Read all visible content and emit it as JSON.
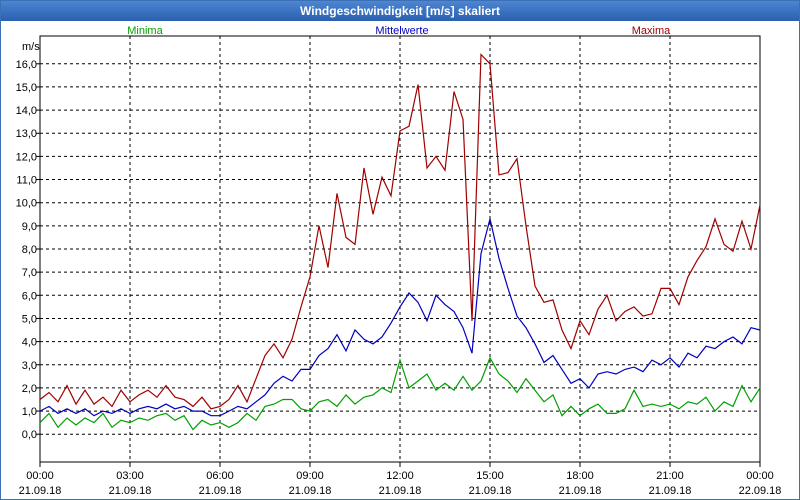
{
  "window": {
    "title": "Windgeschwindigkeit [m/s] skaliert"
  },
  "chart_data": {
    "type": "line",
    "title": "Windgeschwindigkeit [m/s] skaliert",
    "ylabel": "m/s",
    "xlabel": "",
    "ylim": [
      -1.2,
      17.2
    ],
    "xlim_hours": [
      0,
      24
    ],
    "yticks": [
      "0,0",
      "1,0",
      "2,0",
      "3,0",
      "4,0",
      "5,0",
      "6,0",
      "7,0",
      "8,0",
      "9,0",
      "10,0",
      "11,0",
      "12,0",
      "13,0",
      "14,0",
      "15,0",
      "16,0"
    ],
    "ytick_values": [
      0,
      1,
      2,
      3,
      4,
      5,
      6,
      7,
      8,
      9,
      10,
      11,
      12,
      13,
      14,
      15,
      16
    ],
    "xticks": [
      {
        "time": "00:00",
        "date": "21.09.18",
        "hour": 0
      },
      {
        "time": "03:00",
        "date": "21.09.18",
        "hour": 3
      },
      {
        "time": "06:00",
        "date": "21.09.18",
        "hour": 6
      },
      {
        "time": "09:00",
        "date": "21.09.18",
        "hour": 9
      },
      {
        "time": "12:00",
        "date": "21.09.18",
        "hour": 12
      },
      {
        "time": "15:00",
        "date": "21.09.18",
        "hour": 15
      },
      {
        "time": "18:00",
        "date": "21.09.18",
        "hour": 18
      },
      {
        "time": "21:00",
        "date": "21.09.18",
        "hour": 21
      },
      {
        "time": "00:00",
        "date": "22.09.18",
        "hour": 24
      }
    ],
    "grid": true,
    "legend_position": "top",
    "series": [
      {
        "name": "Minima",
        "color": "#00a000",
        "points": [
          [
            0,
            0.5
          ],
          [
            0.3,
            0.9
          ],
          [
            0.6,
            0.3
          ],
          [
            0.9,
            0.7
          ],
          [
            1.2,
            0.4
          ],
          [
            1.5,
            0.7
          ],
          [
            1.8,
            0.5
          ],
          [
            2.1,
            0.9
          ],
          [
            2.4,
            0.3
          ],
          [
            2.7,
            0.6
          ],
          [
            3.0,
            0.5
          ],
          [
            3.3,
            0.7
          ],
          [
            3.6,
            0.6
          ],
          [
            3.9,
            0.8
          ],
          [
            4.2,
            0.9
          ],
          [
            4.5,
            0.6
          ],
          [
            4.8,
            0.8
          ],
          [
            5.1,
            0.2
          ],
          [
            5.4,
            0.6
          ],
          [
            5.7,
            0.4
          ],
          [
            6.0,
            0.5
          ],
          [
            6.3,
            0.3
          ],
          [
            6.6,
            0.5
          ],
          [
            6.9,
            0.9
          ],
          [
            7.2,
            0.6
          ],
          [
            7.5,
            1.2
          ],
          [
            7.8,
            1.3
          ],
          [
            8.1,
            1.5
          ],
          [
            8.4,
            1.5
          ],
          [
            8.7,
            1.1
          ],
          [
            9.0,
            1.0
          ],
          [
            9.3,
            1.4
          ],
          [
            9.6,
            1.5
          ],
          [
            9.9,
            1.2
          ],
          [
            10.2,
            1.7
          ],
          [
            10.5,
            1.3
          ],
          [
            10.8,
            1.6
          ],
          [
            11.1,
            1.7
          ],
          [
            11.4,
            2.0
          ],
          [
            11.7,
            1.8
          ],
          [
            12.0,
            3.2
          ],
          [
            12.3,
            2.0
          ],
          [
            12.6,
            2.3
          ],
          [
            12.9,
            2.6
          ],
          [
            13.2,
            1.9
          ],
          [
            13.5,
            2.2
          ],
          [
            13.8,
            1.9
          ],
          [
            14.1,
            2.5
          ],
          [
            14.4,
            1.9
          ],
          [
            14.7,
            2.3
          ],
          [
            15.0,
            3.3
          ],
          [
            15.3,
            2.6
          ],
          [
            15.6,
            2.3
          ],
          [
            15.9,
            1.8
          ],
          [
            16.2,
            2.4
          ],
          [
            16.5,
            1.9
          ],
          [
            16.8,
            1.4
          ],
          [
            17.1,
            1.7
          ],
          [
            17.4,
            0.8
          ],
          [
            17.7,
            1.2
          ],
          [
            18.0,
            0.8
          ],
          [
            18.3,
            1.1
          ],
          [
            18.6,
            1.3
          ],
          [
            18.9,
            0.9
          ],
          [
            19.2,
            0.9
          ],
          [
            19.5,
            1.1
          ],
          [
            19.8,
            1.9
          ],
          [
            20.1,
            1.2
          ],
          [
            20.4,
            1.3
          ],
          [
            20.7,
            1.2
          ],
          [
            21.0,
            1.3
          ],
          [
            21.3,
            1.1
          ],
          [
            21.6,
            1.4
          ],
          [
            21.9,
            1.3
          ],
          [
            22.2,
            1.6
          ],
          [
            22.5,
            1.0
          ],
          [
            22.8,
            1.4
          ],
          [
            23.1,
            1.2
          ],
          [
            23.4,
            2.1
          ],
          [
            23.7,
            1.4
          ],
          [
            24.0,
            2.0
          ]
        ]
      },
      {
        "name": "Mittelwerte",
        "color": "#0000c0",
        "points": [
          [
            0,
            1.0
          ],
          [
            0.3,
            1.2
          ],
          [
            0.6,
            0.9
          ],
          [
            0.9,
            1.1
          ],
          [
            1.2,
            0.9
          ],
          [
            1.5,
            1.1
          ],
          [
            1.8,
            0.8
          ],
          [
            2.1,
            1.0
          ],
          [
            2.4,
            0.9
          ],
          [
            2.7,
            1.1
          ],
          [
            3.0,
            0.9
          ],
          [
            3.3,
            1.1
          ],
          [
            3.6,
            1.2
          ],
          [
            3.9,
            1.1
          ],
          [
            4.2,
            1.3
          ],
          [
            4.5,
            1.1
          ],
          [
            4.8,
            1.2
          ],
          [
            5.1,
            1.0
          ],
          [
            5.4,
            1.0
          ],
          [
            5.7,
            0.8
          ],
          [
            6.0,
            0.8
          ],
          [
            6.3,
            1.0
          ],
          [
            6.6,
            1.2
          ],
          [
            6.9,
            1.1
          ],
          [
            7.2,
            1.4
          ],
          [
            7.5,
            1.7
          ],
          [
            7.8,
            2.2
          ],
          [
            8.1,
            2.5
          ],
          [
            8.4,
            2.3
          ],
          [
            8.7,
            2.8
          ],
          [
            9.0,
            2.8
          ],
          [
            9.3,
            3.4
          ],
          [
            9.6,
            3.7
          ],
          [
            9.9,
            4.3
          ],
          [
            10.2,
            3.6
          ],
          [
            10.5,
            4.5
          ],
          [
            10.8,
            4.1
          ],
          [
            11.1,
            3.9
          ],
          [
            11.4,
            4.2
          ],
          [
            11.7,
            4.8
          ],
          [
            12.0,
            5.5
          ],
          [
            12.3,
            6.1
          ],
          [
            12.6,
            5.7
          ],
          [
            12.9,
            4.9
          ],
          [
            13.2,
            6.0
          ],
          [
            13.5,
            5.6
          ],
          [
            13.8,
            5.3
          ],
          [
            14.1,
            4.6
          ],
          [
            14.4,
            3.5
          ],
          [
            14.7,
            7.8
          ],
          [
            15.0,
            9.3
          ],
          [
            15.3,
            7.6
          ],
          [
            15.6,
            6.3
          ],
          [
            15.9,
            5.1
          ],
          [
            16.2,
            4.6
          ],
          [
            16.5,
            3.9
          ],
          [
            16.8,
            3.1
          ],
          [
            17.1,
            3.4
          ],
          [
            17.4,
            2.8
          ],
          [
            17.7,
            2.2
          ],
          [
            18.0,
            2.4
          ],
          [
            18.3,
            2.0
          ],
          [
            18.6,
            2.6
          ],
          [
            18.9,
            2.7
          ],
          [
            19.2,
            2.6
          ],
          [
            19.5,
            2.8
          ],
          [
            19.8,
            2.9
          ],
          [
            20.1,
            2.7
          ],
          [
            20.4,
            3.2
          ],
          [
            20.7,
            3.0
          ],
          [
            21.0,
            3.3
          ],
          [
            21.3,
            2.9
          ],
          [
            21.6,
            3.5
          ],
          [
            21.9,
            3.3
          ],
          [
            22.2,
            3.8
          ],
          [
            22.5,
            3.7
          ],
          [
            22.8,
            4.0
          ],
          [
            23.1,
            4.2
          ],
          [
            23.4,
            3.9
          ],
          [
            23.7,
            4.6
          ],
          [
            24.0,
            4.5
          ]
        ]
      },
      {
        "name": "Maxima",
        "color": "#a00000",
        "points": [
          [
            0,
            1.5
          ],
          [
            0.3,
            1.8
          ],
          [
            0.6,
            1.4
          ],
          [
            0.9,
            2.1
          ],
          [
            1.2,
            1.3
          ],
          [
            1.5,
            1.9
          ],
          [
            1.8,
            1.3
          ],
          [
            2.1,
            1.6
          ],
          [
            2.4,
            1.2
          ],
          [
            2.7,
            1.9
          ],
          [
            3.0,
            1.4
          ],
          [
            3.3,
            1.7
          ],
          [
            3.6,
            1.9
          ],
          [
            3.9,
            1.6
          ],
          [
            4.2,
            2.1
          ],
          [
            4.5,
            1.6
          ],
          [
            4.8,
            1.5
          ],
          [
            5.1,
            1.2
          ],
          [
            5.4,
            1.6
          ],
          [
            5.7,
            1.1
          ],
          [
            6.0,
            1.2
          ],
          [
            6.3,
            1.5
          ],
          [
            6.6,
            2.1
          ],
          [
            6.9,
            1.4
          ],
          [
            7.2,
            2.4
          ],
          [
            7.5,
            3.4
          ],
          [
            7.8,
            3.9
          ],
          [
            8.1,
            3.3
          ],
          [
            8.4,
            4.1
          ],
          [
            8.7,
            5.5
          ],
          [
            9.0,
            6.8
          ],
          [
            9.3,
            9.0
          ],
          [
            9.6,
            7.2
          ],
          [
            9.9,
            10.4
          ],
          [
            10.2,
            8.5
          ],
          [
            10.5,
            8.2
          ],
          [
            10.8,
            11.5
          ],
          [
            11.1,
            9.5
          ],
          [
            11.4,
            11.1
          ],
          [
            11.7,
            10.3
          ],
          [
            12.0,
            13.1
          ],
          [
            12.3,
            13.3
          ],
          [
            12.6,
            15.1
          ],
          [
            12.9,
            11.5
          ],
          [
            13.2,
            12.0
          ],
          [
            13.5,
            11.4
          ],
          [
            13.8,
            14.8
          ],
          [
            14.1,
            13.6
          ],
          [
            14.4,
            4.9
          ],
          [
            14.7,
            16.4
          ],
          [
            15.0,
            16.0
          ],
          [
            15.3,
            11.2
          ],
          [
            15.6,
            11.3
          ],
          [
            15.9,
            11.9
          ],
          [
            16.2,
            9.0
          ],
          [
            16.5,
            6.4
          ],
          [
            16.8,
            5.7
          ],
          [
            17.1,
            5.8
          ],
          [
            17.4,
            4.5
          ],
          [
            17.7,
            3.7
          ],
          [
            18.0,
            4.9
          ],
          [
            18.3,
            4.3
          ],
          [
            18.6,
            5.4
          ],
          [
            18.9,
            6.0
          ],
          [
            19.2,
            4.9
          ],
          [
            19.5,
            5.3
          ],
          [
            19.8,
            5.5
          ],
          [
            20.1,
            5.1
          ],
          [
            20.4,
            5.2
          ],
          [
            20.7,
            6.3
          ],
          [
            21.0,
            6.3
          ],
          [
            21.3,
            5.6
          ],
          [
            21.6,
            6.8
          ],
          [
            21.9,
            7.5
          ],
          [
            22.2,
            8.1
          ],
          [
            22.5,
            9.3
          ],
          [
            22.8,
            8.2
          ],
          [
            23.1,
            7.9
          ],
          [
            23.4,
            9.2
          ],
          [
            23.7,
            8.0
          ],
          [
            24.0,
            9.9
          ]
        ]
      }
    ]
  }
}
